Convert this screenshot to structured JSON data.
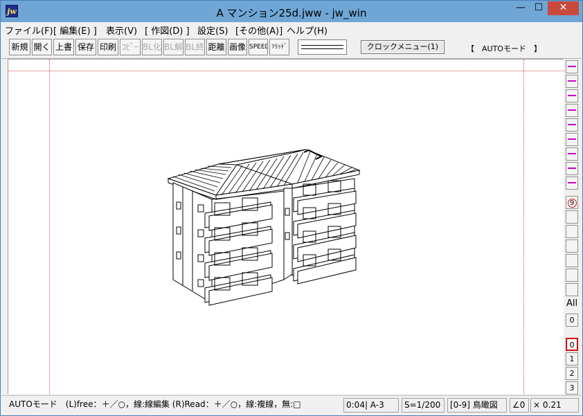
{
  "window": {
    "title": "A マンション25d.jww - jw_win",
    "icon_text": "jw",
    "controls": {
      "minimize": "—",
      "maximize": "☐",
      "close": "✕"
    }
  },
  "menu": [
    "ファイル(F)",
    "[ 編集(E) ]",
    "表示(V)",
    "[ 作図(D) ]",
    "設定(S)",
    "[その他(A)]",
    "ヘルプ(H)"
  ],
  "toolbar": {
    "buttons": [
      {
        "label": "新規",
        "enabled": true
      },
      {
        "label": "開く",
        "enabled": true
      },
      {
        "label": "上書",
        "enabled": true
      },
      {
        "label": "保存",
        "enabled": true
      },
      {
        "label": "印刷",
        "enabled": true
      },
      {
        "label": "ｺﾋﾟｰ",
        "enabled": false
      },
      {
        "label": "BL化",
        "enabled": false
      },
      {
        "label": "BL解",
        "enabled": false
      },
      {
        "label": "BL終",
        "enabled": false
      },
      {
        "label": "距離",
        "enabled": true
      },
      {
        "label": "画像",
        "enabled": true
      },
      {
        "label": "SPEED",
        "enabled": true
      },
      {
        "label": "ｿﾘｯﾄﾞ",
        "enabled": true
      }
    ],
    "clock_menu": "クロックメニュー(1)",
    "mode": "【　AUTOモード　】"
  },
  "layers": {
    "circled": "9",
    "all_label": "All",
    "zero_label": "0",
    "groups": [
      "0",
      "1",
      "2",
      "3"
    ]
  },
  "status": {
    "message": "AUTOモード　(L)free：＋／○，線:線編集 (R)Read：＋／○，線:複線，無:□",
    "layer_info": "0:04| A-3",
    "scale": "S=1/200",
    "view": "[0-9] 鳥瞰図",
    "angle": "∠0",
    "factor": "× 0.21"
  }
}
